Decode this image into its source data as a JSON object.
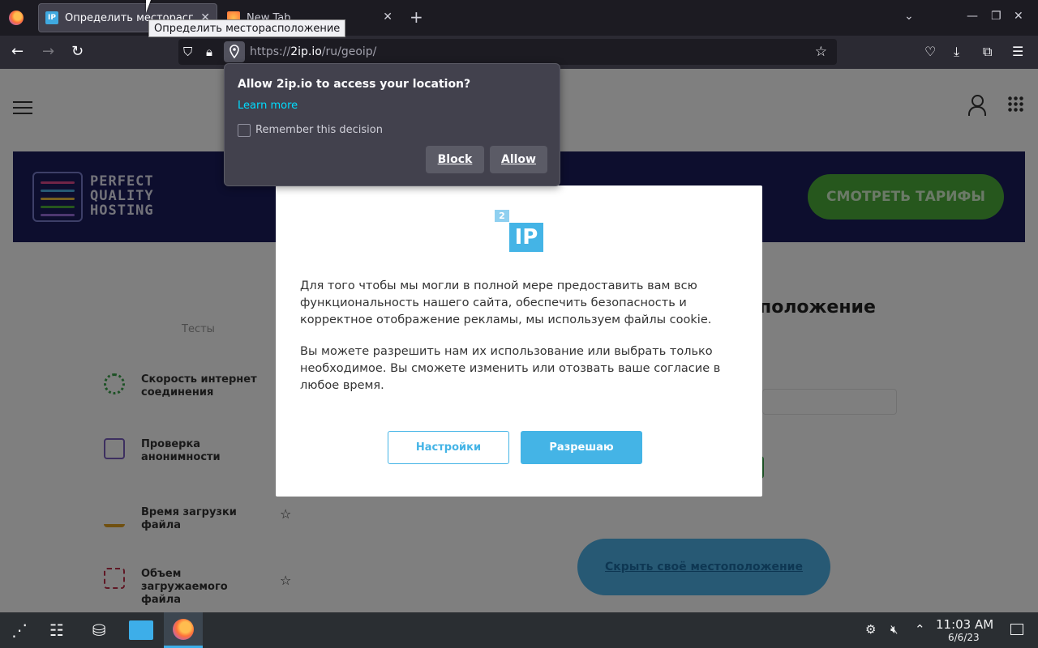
{
  "browser": {
    "tabs": [
      {
        "label": "Определить месторасположение",
        "active": true,
        "favicon": "IP"
      },
      {
        "label": "New Tab",
        "active": false,
        "favicon": "firefox"
      }
    ],
    "tooltip": "Определить месторасположение",
    "url": {
      "prefix": "https://",
      "domain": "2ip.io",
      "path": "/ru/geoip/"
    }
  },
  "permission_popup": {
    "title": "Allow 2ip.io to access your location?",
    "learn_more": "Learn more",
    "remember": "Remember this decision",
    "block_label": "Block",
    "allow_label": "Allow"
  },
  "page": {
    "banner": {
      "line1": "PERFECT",
      "line2": "QUALITY",
      "line3": "HOSTING",
      "cta": "СМОТРЕТЬ ТАРИФЫ",
      "colors": [
        "#1a1d5c",
        "#4caf3a"
      ]
    },
    "heading_fragment": "положение",
    "sidebar_caption": "Тесты",
    "sidebar_items": [
      {
        "label": "Скорость интернет соединения",
        "icon": "speedometer-icon"
      },
      {
        "label": "Проверка анонимности",
        "icon": "anonymity-icon"
      },
      {
        "label": "Время загрузки файла",
        "icon": "download-icon"
      },
      {
        "label": "Объем загружаемого файла",
        "icon": "file-size-icon"
      }
    ],
    "hide_location": "Скрыть своё местоположение"
  },
  "cookie_modal": {
    "logo_small": "2",
    "logo_big": "IP",
    "paragraph1": "Для того чтобы мы могли в полной мере предоставить вам всю функциональность нашего сайта, обеспечить безопасность и корректное отображение рекламы, мы используем файлы cookie.",
    "paragraph2": "Вы можете разрешить нам их использование или выбрать только необходимое. Вы сможете изменить или отозвать ваше согласие в любое время.",
    "settings_label": "Настройки",
    "accept_label": "Разрешаю",
    "accent": "#44b4e6"
  },
  "taskbar": {
    "time": "11:03 AM",
    "date": "6/6/23"
  }
}
